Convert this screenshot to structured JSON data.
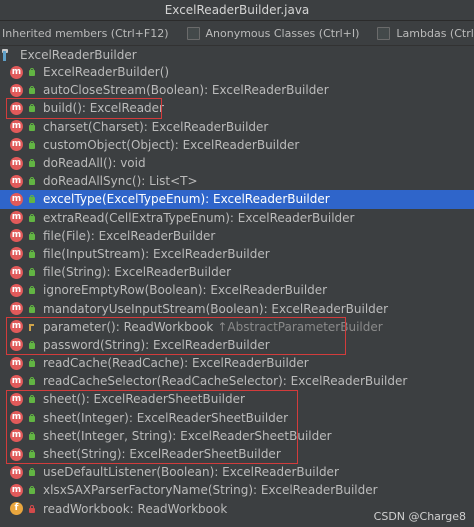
{
  "window": {
    "title": "ExcelReaderBuilder.java"
  },
  "filters": [
    {
      "label": "Inherited members (Ctrl+F12)",
      "has_checkbox": false
    },
    {
      "label": "Anonymous Classes (Ctrl+I)",
      "has_checkbox": true,
      "checked": false
    },
    {
      "label": "Lambdas (Ctrl+L)",
      "has_checkbox": true,
      "checked": false
    }
  ],
  "root": {
    "label": "ExcelReaderBuilder"
  },
  "members": [
    {
      "label": "ExcelReaderBuilder()",
      "kind": "m",
      "vis": "public"
    },
    {
      "label": "autoCloseStream(Boolean): ExcelReaderBuilder",
      "kind": "m",
      "vis": "public"
    },
    {
      "label": "build(): ExcelReader",
      "kind": "m",
      "vis": "public"
    },
    {
      "label": "charset(Charset): ExcelReaderBuilder",
      "kind": "m",
      "vis": "public"
    },
    {
      "label": "customObject(Object): ExcelReaderBuilder",
      "kind": "m",
      "vis": "public"
    },
    {
      "label": "doReadAll(): void",
      "kind": "m",
      "vis": "public"
    },
    {
      "label": "doReadAllSync(): List<T>",
      "kind": "m",
      "vis": "public"
    },
    {
      "label": "excelType(ExcelTypeEnum): ExcelReaderBuilder",
      "kind": "m",
      "vis": "public",
      "selected": true
    },
    {
      "label": "extraRead(CellExtraTypeEnum): ExcelReaderBuilder",
      "kind": "m",
      "vis": "public"
    },
    {
      "label": "file(File): ExcelReaderBuilder",
      "kind": "m",
      "vis": "public"
    },
    {
      "label": "file(InputStream): ExcelReaderBuilder",
      "kind": "m",
      "vis": "public"
    },
    {
      "label": "file(String): ExcelReaderBuilder",
      "kind": "m",
      "vis": "public"
    },
    {
      "label": "ignoreEmptyRow(Boolean): ExcelReaderBuilder",
      "kind": "m",
      "vis": "public"
    },
    {
      "label": "mandatoryUseInputStream(Boolean): ExcelReaderBuilder",
      "kind": "m",
      "vis": "public"
    },
    {
      "label": "parameter(): ReadWorkbook",
      "kind": "m",
      "vis": "protected",
      "inherit": "↑AbstractParameterBuilder"
    },
    {
      "label": "password(String): ExcelReaderBuilder",
      "kind": "m",
      "vis": "public"
    },
    {
      "label": "readCache(ReadCache): ExcelReaderBuilder",
      "kind": "m",
      "vis": "public"
    },
    {
      "label": "readCacheSelector(ReadCacheSelector): ExcelReaderBuilder",
      "kind": "m",
      "vis": "public"
    },
    {
      "label": "sheet(): ExcelReaderSheetBuilder",
      "kind": "m",
      "vis": "public"
    },
    {
      "label": "sheet(Integer): ExcelReaderSheetBuilder",
      "kind": "m",
      "vis": "public"
    },
    {
      "label": "sheet(Integer, String): ExcelReaderSheetBuilder",
      "kind": "m",
      "vis": "public"
    },
    {
      "label": "sheet(String): ExcelReaderSheetBuilder",
      "kind": "m",
      "vis": "public"
    },
    {
      "label": "useDefaultListener(Boolean): ExcelReaderBuilder",
      "kind": "m",
      "vis": "public"
    },
    {
      "label": "xlsxSAXParserFactoryName(String): ExcelReaderBuilder",
      "kind": "m",
      "vis": "public"
    },
    {
      "label": "readWorkbook: ReadWorkbook",
      "kind": "f",
      "vis": "private"
    }
  ],
  "watermark": "CSDN @Charge8"
}
